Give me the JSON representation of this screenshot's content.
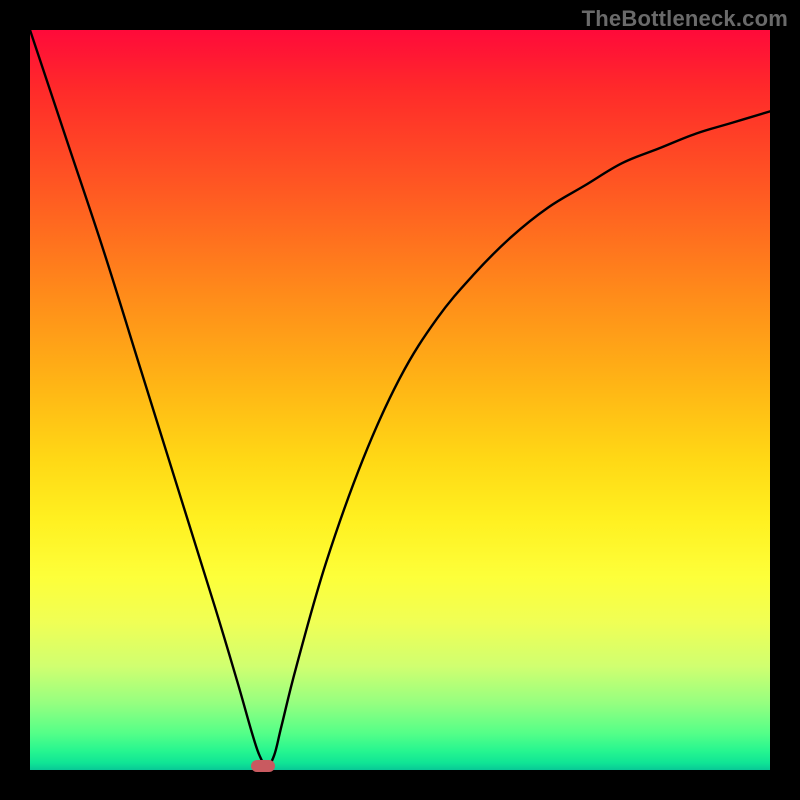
{
  "watermark": {
    "text": "TheBottleneck.com"
  },
  "chart_data": {
    "type": "line",
    "title": "",
    "xlabel": "",
    "ylabel": "",
    "xlim": [
      0,
      100
    ],
    "ylim": [
      0,
      100
    ],
    "background_gradient": {
      "top": "#ff0a3a",
      "bottom": "#08c896",
      "meaning": "red = high bottleneck, green = low bottleneck"
    },
    "series": [
      {
        "name": "bottleneck-curve",
        "x": [
          0,
          5,
          10,
          15,
          20,
          25,
          28,
          30,
          31,
          32,
          33,
          34,
          36,
          40,
          45,
          50,
          55,
          60,
          65,
          70,
          75,
          80,
          85,
          90,
          95,
          100
        ],
        "y": [
          100,
          85,
          70,
          54,
          38,
          22,
          12,
          5,
          2,
          0.5,
          2,
          6,
          14,
          28,
          42,
          53,
          61,
          67,
          72,
          76,
          79,
          82,
          84,
          86,
          87.5,
          89
        ]
      }
    ],
    "annotations": [
      {
        "name": "optimal-point-marker",
        "x": 31.5,
        "y": 0.5,
        "shape": "pill",
        "color": "#c95a60"
      }
    ]
  }
}
